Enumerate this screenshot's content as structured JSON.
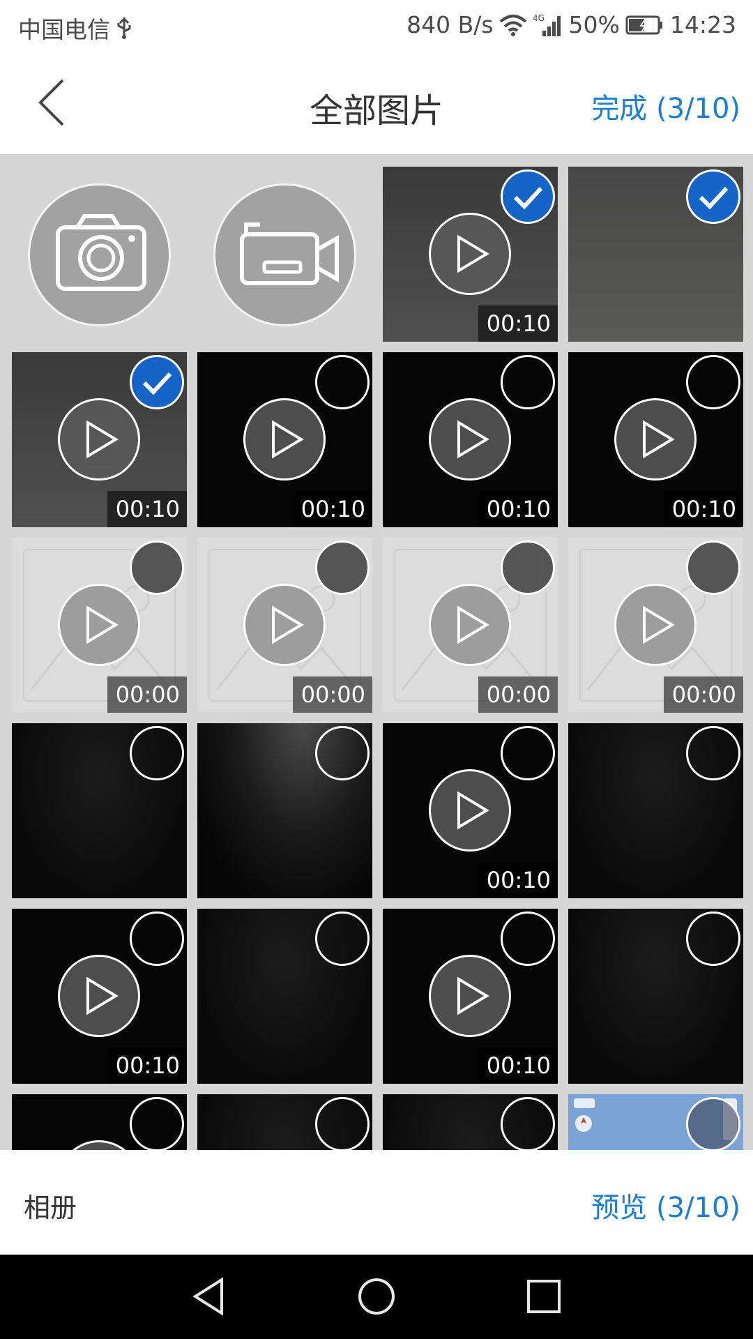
{
  "status_bar": {
    "carrier": "中国电信",
    "speed": "840 B/s",
    "network": "4G",
    "battery": "50%",
    "time": "14:23",
    "icons": [
      "usb-icon",
      "wifi-icon",
      "signal-icon",
      "battery-icon"
    ]
  },
  "header": {
    "title": "全部图片",
    "done_label": "完成 (3/10)"
  },
  "capture_buttons": [
    {
      "name": "camera",
      "icon": "camera-icon"
    },
    {
      "name": "video",
      "icon": "video-camera-icon"
    }
  ],
  "media": [
    {
      "kind": "video",
      "duration": "00:10",
      "selected": true
    },
    {
      "kind": "image",
      "selected": true
    },
    {
      "kind": "video",
      "duration": "00:10",
      "selected": true
    },
    {
      "kind": "video",
      "duration": "00:10",
      "selected": false
    },
    {
      "kind": "video",
      "duration": "00:10",
      "selected": false
    },
    {
      "kind": "video",
      "duration": "00:10",
      "selected": false
    },
    {
      "kind": "video",
      "duration": "00:00",
      "selected": false,
      "disabled": true
    },
    {
      "kind": "video",
      "duration": "00:00",
      "selected": false,
      "disabled": true
    },
    {
      "kind": "video",
      "duration": "00:00",
      "selected": false,
      "disabled": true
    },
    {
      "kind": "video",
      "duration": "00:00",
      "selected": false,
      "disabled": true
    },
    {
      "kind": "image",
      "selected": false
    },
    {
      "kind": "image",
      "selected": false
    },
    {
      "kind": "video",
      "duration": "00:10",
      "selected": false
    },
    {
      "kind": "image",
      "selected": false
    },
    {
      "kind": "video",
      "duration": "00:10",
      "selected": false
    },
    {
      "kind": "image",
      "selected": false
    },
    {
      "kind": "video",
      "duration": "00:10",
      "selected": false
    },
    {
      "kind": "image",
      "selected": false
    },
    {
      "kind": "video",
      "selected": false
    },
    {
      "kind": "image",
      "selected": false
    },
    {
      "kind": "image",
      "selected": false
    },
    {
      "kind": "image",
      "selected": false
    }
  ],
  "footer": {
    "album_label": "相册",
    "preview_label": "预览 (3/10)"
  },
  "nav_bar": {
    "buttons": [
      "back-triangle-icon",
      "home-circle-icon",
      "recents-square-icon"
    ]
  },
  "colors": {
    "accent": "#1a7fd4",
    "selected_check": "#1565c8",
    "grid_background": "#d6d6d6"
  }
}
